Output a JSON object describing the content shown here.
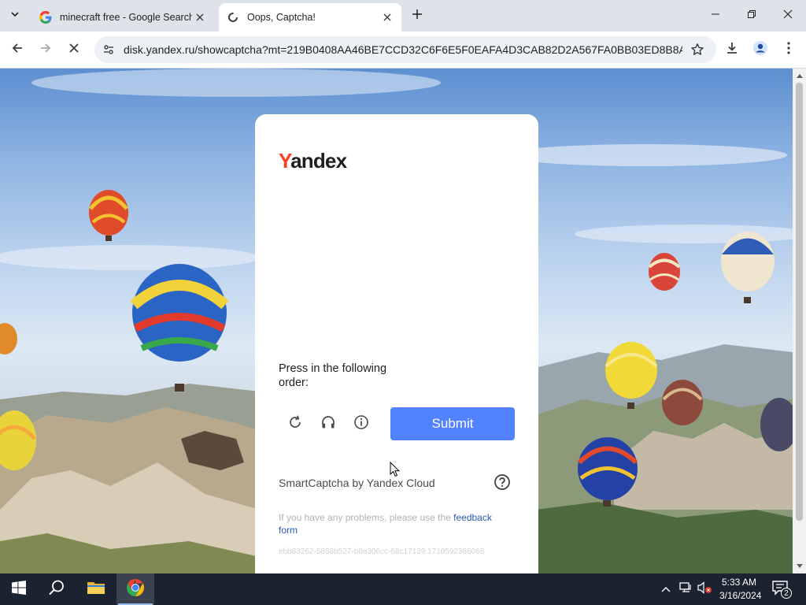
{
  "browser": {
    "tabs": [
      {
        "title": "minecraft free - Google Search",
        "favicon": "google-icon",
        "active": false
      },
      {
        "title": "Oops, Captcha!",
        "favicon": "loading-spinner-icon",
        "active": true
      }
    ],
    "url": "disk.yandex.ru/showcaptcha?mt=219B0408AA46BE7CCD32C6F6E5F0EAFA4D3CAB82D2A567FA0BB03ED8B8A647...",
    "loading": true
  },
  "captcha": {
    "logo_first_letter": "Y",
    "logo_rest": "andex",
    "instruction": "Press in the following order:",
    "submit_label": "Submit",
    "brand_text": "SmartCaptcha by Yandex Cloud",
    "problem_text": "If you have any problems, please use the ",
    "feedback_link": "feedback form",
    "request_id": "ebb83262-5858b527-b8a306cc-68c17139:1710592386068",
    "accent_color": "#5282ff"
  },
  "taskbar": {
    "time": "5:33 AM",
    "date": "3/16/2024",
    "notification_count": "2"
  }
}
